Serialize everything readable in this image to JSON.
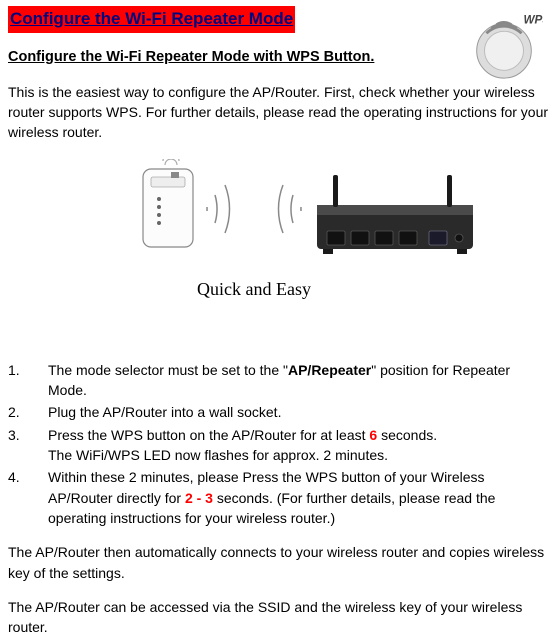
{
  "title": "Configure the Wi-Fi Repeater Mode",
  "subtitle": "Configure the Wi-Fi Repeater Mode with WPS Button.",
  "intro": "This is the easiest way to configure the AP/Router. First, check whether your wireless router supports WPS. For further details, please read the operating instructions for your wireless router.",
  "wps_label": "WPS",
  "illustration_caption": "Quick and Easy",
  "steps": {
    "s1_num": "1.",
    "s1_a": "The mode selector must be set to the \"",
    "s1_bold": "AP/Repeater",
    "s1_b": "\" position for Repeater Mode.",
    "s2_num": "2.",
    "s2": "Plug the AP/Router into a wall socket.",
    "s3_num": "3.",
    "s3_a": "Press the WPS button on the AP/Router for at least ",
    "s3_red": "6",
    "s3_b": " seconds.",
    "s3_line2": "The WiFi/WPS LED now flashes for approx. 2 minutes.",
    "s4_num": "4.",
    "s4_a": "Within these 2 minutes, please Press the WPS button of your Wireless AP/Router directly for ",
    "s4_red": "2 - 3",
    "s4_b": " seconds.   (For further details, please read the operating instructions for your wireless router.)"
  },
  "outro1": "The AP/Router then automatically connects to your wireless router and copies wireless key of the settings.",
  "outro2": "The AP/Router can be accessed via the SSID and the wireless key of your wireless router."
}
